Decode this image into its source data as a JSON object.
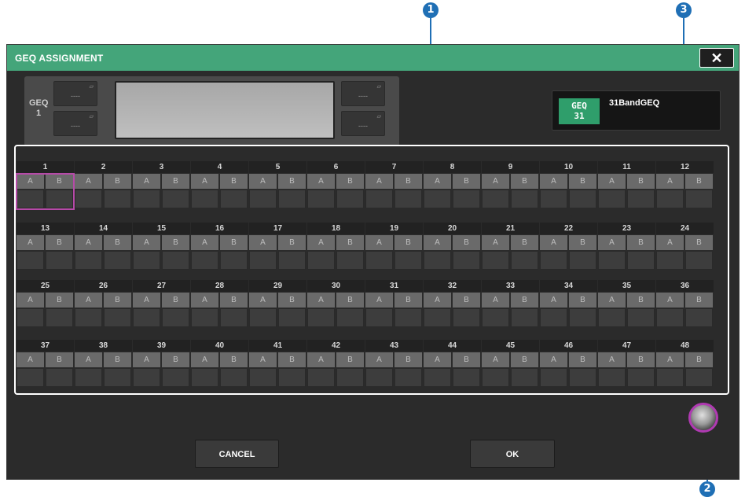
{
  "callouts": [
    "1",
    "2",
    "3"
  ],
  "window": {
    "title": "GEQ ASSIGNMENT",
    "close_icon": "close-icon"
  },
  "geq_panel": {
    "label_line1": "GEQ",
    "label_line2": "1",
    "slot_buttons": [
      "----",
      "----",
      "----",
      "----"
    ]
  },
  "type_selector": {
    "logo_line1": "GEQ",
    "logo_line2": "31",
    "name": "31BandGEQ"
  },
  "rack_grid": {
    "a_label": "A",
    "b_label": "B",
    "numbers": [
      "1",
      "2",
      "3",
      "4",
      "5",
      "6",
      "7",
      "8",
      "9",
      "10",
      "11",
      "12",
      "13",
      "14",
      "15",
      "16",
      "17",
      "18",
      "19",
      "20",
      "21",
      "22",
      "23",
      "24",
      "25",
      "26",
      "27",
      "28",
      "29",
      "30",
      "31",
      "32",
      "33",
      "34",
      "35",
      "36",
      "37",
      "38",
      "39",
      "40",
      "41",
      "42",
      "43",
      "44",
      "45",
      "46",
      "47",
      "48"
    ],
    "selected": "1"
  },
  "buttons": {
    "cancel": "CANCEL",
    "ok": "OK"
  },
  "colors": {
    "titlebar": "#44a57a",
    "selection": "#b64aa8",
    "callout": "#1f6fb5"
  }
}
